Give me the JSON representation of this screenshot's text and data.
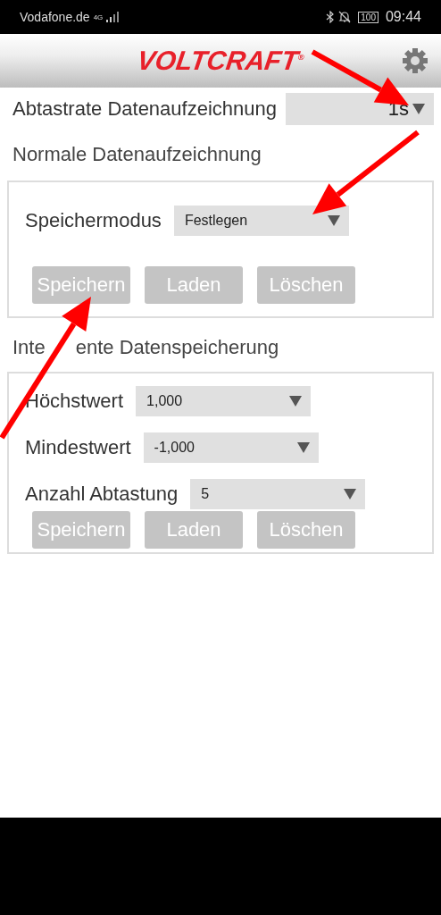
{
  "status_bar": {
    "carrier": "Vodafone.de",
    "network": "4G",
    "battery": "100",
    "time": "09:44"
  },
  "header": {
    "logo": "VOLTCRAFT",
    "logo_mark": "®"
  },
  "sample_rate": {
    "label": "Abtastrate Datenaufzeichnung",
    "value": "1s"
  },
  "sections": [
    {
      "title_parts": [
        "Normale Datenaufzeichnung"
      ],
      "fields": [
        {
          "label": "Speichermodus",
          "value": "Festlegen"
        }
      ],
      "buttons": [
        "Speichern",
        "Laden",
        "Löschen"
      ]
    },
    {
      "title_parts": [
        "Inte",
        "ente Datenspeicherung"
      ],
      "fields": [
        {
          "label": "Höchstwert",
          "value": "1,000"
        },
        {
          "label": "Mindestwert",
          "value": "-1,000"
        },
        {
          "label": "Anzahl Abtastung",
          "value": "5"
        }
      ],
      "buttons": [
        "Speichern",
        "Laden",
        "Löschen"
      ]
    }
  ]
}
